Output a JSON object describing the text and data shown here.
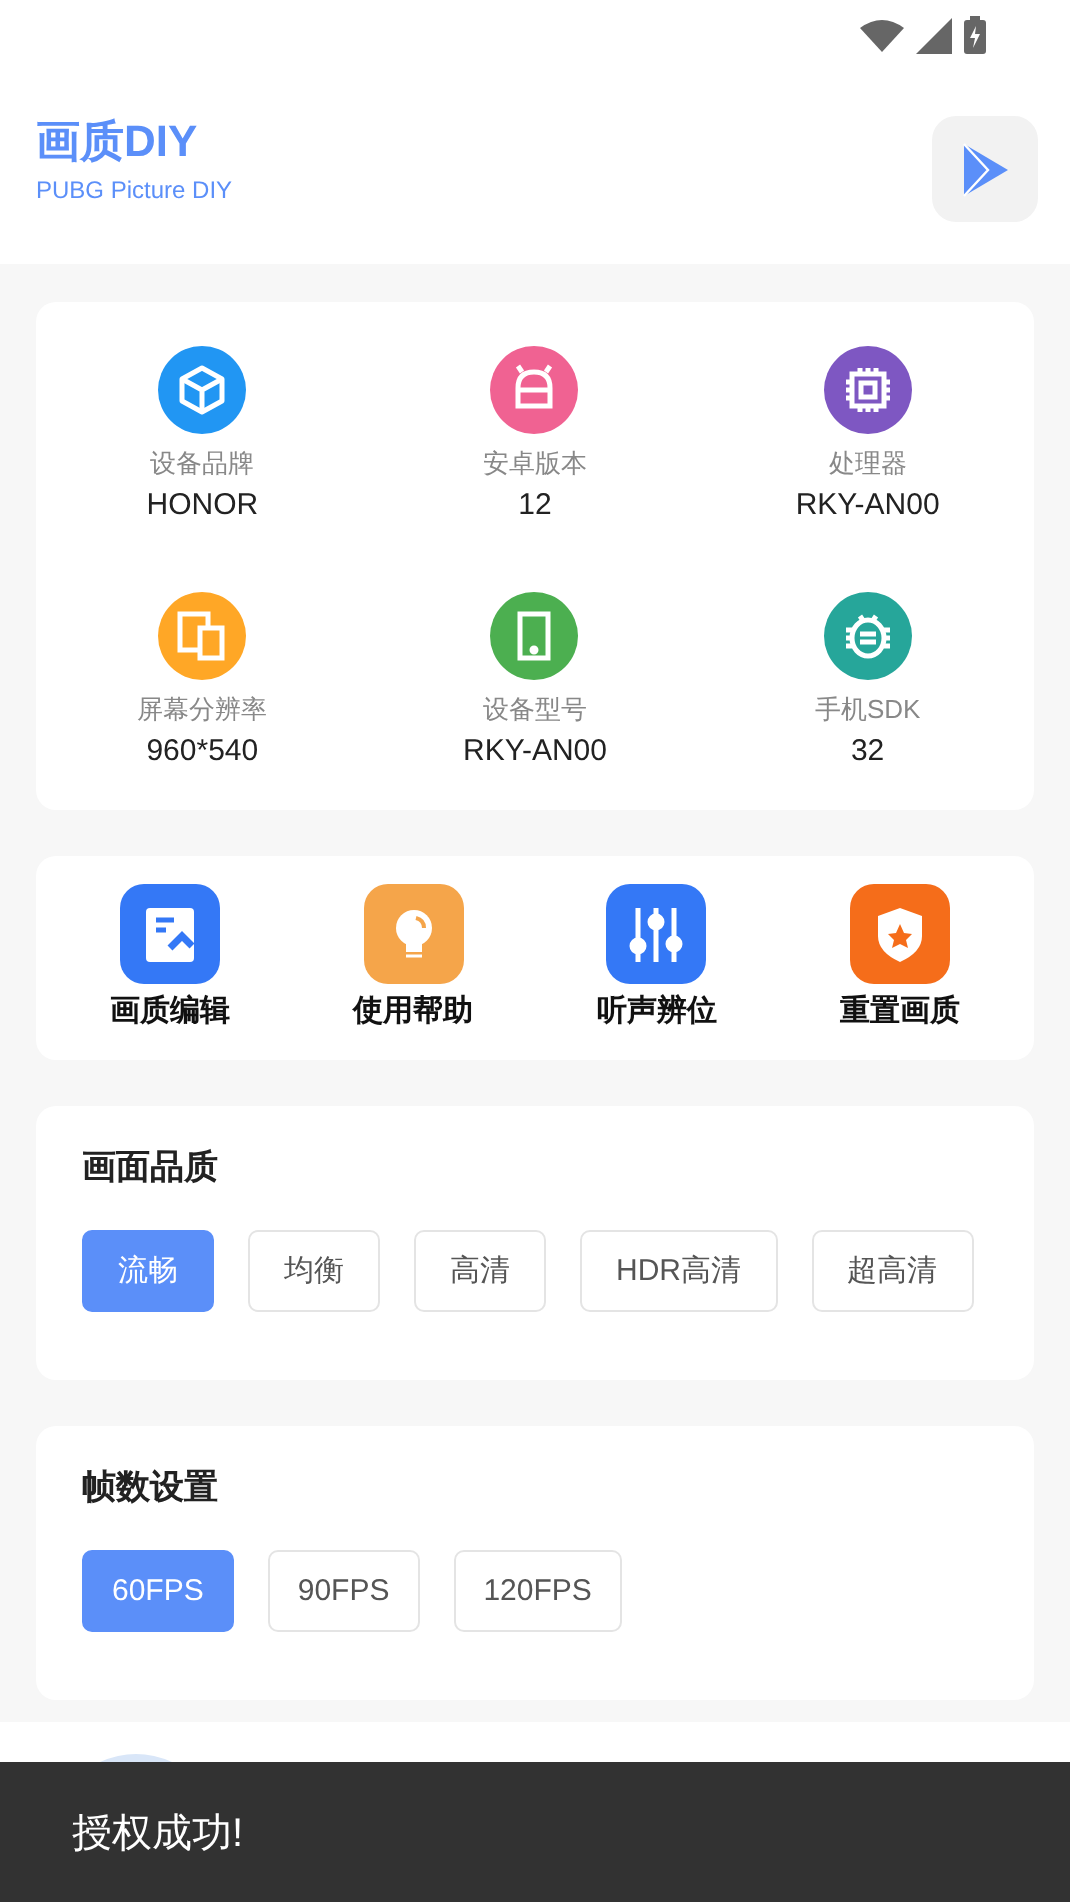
{
  "header": {
    "title": "画质DIY",
    "subtitle": "PUBG Picture DIY"
  },
  "device_info": [
    {
      "label": "设备品牌",
      "value": "HONOR",
      "color": "#2196f3"
    },
    {
      "label": "安卓版本",
      "value": "12",
      "color": "#f06292"
    },
    {
      "label": "处理器",
      "value": "RKY-AN00",
      "color": "#7e57c2"
    },
    {
      "label": "屏幕分辨率",
      "value": "960*540",
      "color": "#ffa726"
    },
    {
      "label": "设备型号",
      "value": "RKY-AN00",
      "color": "#4caf50"
    },
    {
      "label": "手机SDK",
      "value": "32",
      "color": "#26a69a"
    }
  ],
  "tools": [
    {
      "label": "画质编辑",
      "color": "#3478f6"
    },
    {
      "label": "使用帮助",
      "color": "#f5a54a"
    },
    {
      "label": "听声辨位",
      "color": "#3478f6"
    },
    {
      "label": "重置画质",
      "color": "#f56d1a"
    }
  ],
  "quality": {
    "title": "画面品质",
    "options": [
      {
        "label": "流畅",
        "selected": true
      },
      {
        "label": "均衡",
        "selected": false
      },
      {
        "label": "高清",
        "selected": false
      },
      {
        "label": "HDR高清",
        "selected": false
      },
      {
        "label": "超高清",
        "selected": false
      }
    ]
  },
  "fps": {
    "title": "帧数设置",
    "options": [
      {
        "label": "60FPS",
        "selected": true
      },
      {
        "label": "90FPS",
        "selected": false
      },
      {
        "label": "120FPS",
        "selected": false
      }
    ]
  },
  "toast": "授权成功!"
}
